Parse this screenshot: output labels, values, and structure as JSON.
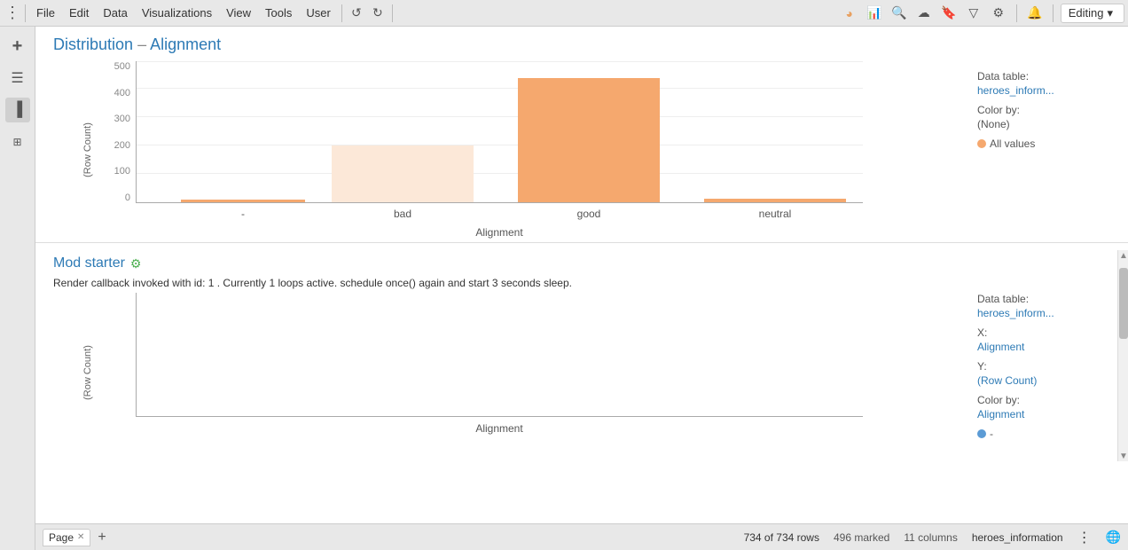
{
  "toolbar": {
    "menu_items": [
      "File",
      "Edit",
      "Data",
      "Visualizations",
      "View",
      "Tools",
      "User"
    ],
    "editing_label": "Editing"
  },
  "sidebar": {
    "items": [
      {
        "name": "add",
        "icon": "+"
      },
      {
        "name": "list",
        "icon": "☰"
      },
      {
        "name": "chart",
        "icon": "📊"
      },
      {
        "name": "grid",
        "icon": "⊞"
      }
    ]
  },
  "chart1": {
    "title": "Distribution",
    "title_dash": "–",
    "title_emphasis": "Alignment",
    "y_axis_label": "(Row Count)",
    "x_axis_label": "Alignment",
    "y_ticks": [
      "0",
      "100",
      "200",
      "300",
      "400",
      "500"
    ],
    "bars": [
      {
        "label": "-",
        "height_pct": 0,
        "type": "tiny",
        "x_pct": 10
      },
      {
        "label": "bad",
        "height_pct": 40,
        "type": "light",
        "x_pct": 30
      },
      {
        "label": "good",
        "height_pct": 90,
        "type": "normal",
        "x_pct": 55
      },
      {
        "label": "neutral",
        "height_pct": 3,
        "type": "tiny",
        "x_pct": 78
      }
    ],
    "right_panel": {
      "data_table_label": "Data table:",
      "data_table_value": "heroes_inform...",
      "color_by_label": "Color by:",
      "color_by_value": "(None)",
      "all_values_label": "All values"
    }
  },
  "chart2": {
    "title": "Mod starter",
    "render_msg": "Render callback invoked with id: 1 . Currently 1 loops active. schedule once() again and start 3 seconds sleep.",
    "y_axis_label": "(Row Count)",
    "x_axis_label": "Alignment",
    "right_panel": {
      "data_table_label": "Data table:",
      "data_table_value": "heroes_inform...",
      "x_label": "X:",
      "x_value": "Alignment",
      "y_label": "Y:",
      "y_value": "(Row Count)",
      "color_by_label": "Color by:",
      "color_by_value": "Alignment",
      "dot_label": "-"
    }
  },
  "status_bar": {
    "tab_label": "Page",
    "rows_text": "734 of 734 rows",
    "marked_text": "496 marked",
    "columns_text": "11 columns",
    "table_name": "heroes_information"
  }
}
